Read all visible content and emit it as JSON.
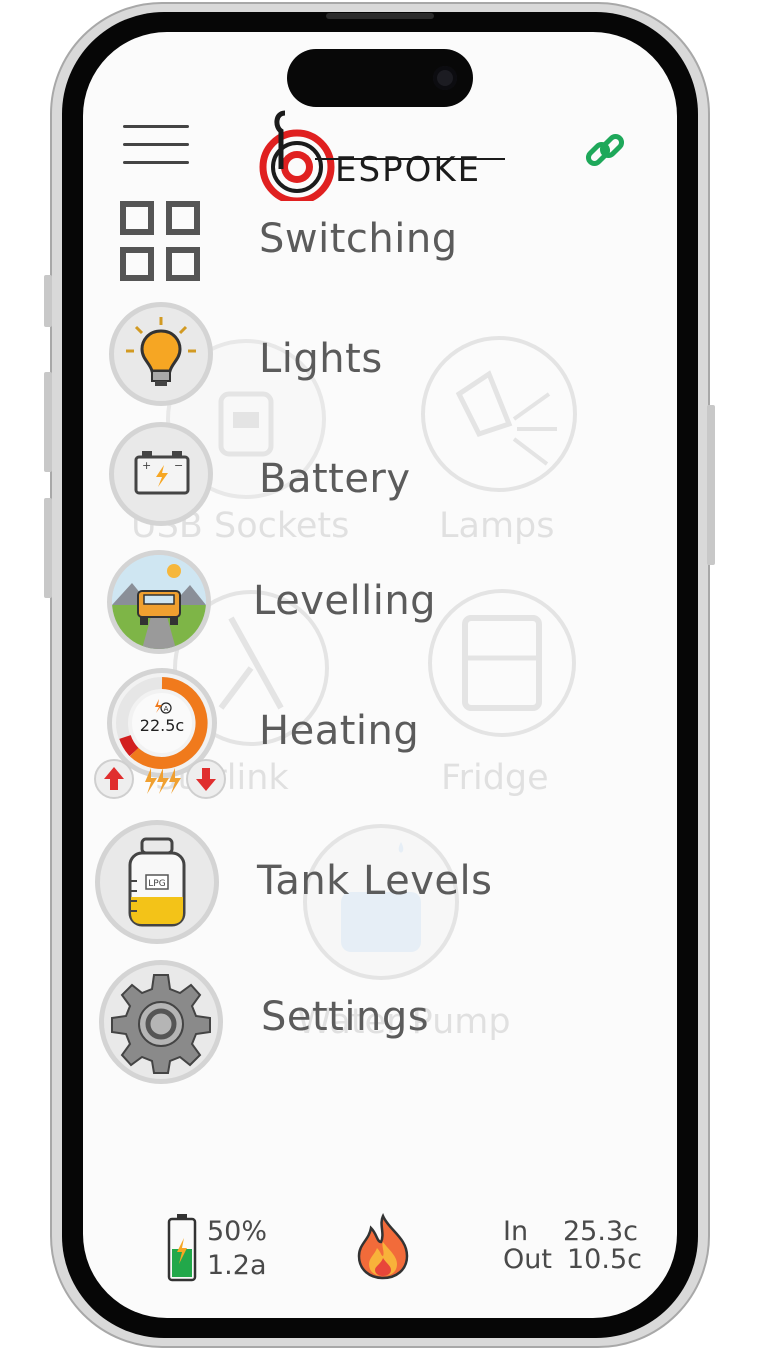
{
  "header": {
    "logo_text": "ESPOKE",
    "menu_icon": "hamburger-menu-icon",
    "link_icon": "link-icon",
    "link_color": "#1ea85a"
  },
  "background_tiles": [
    {
      "label": "USB Sockets",
      "icon": "usb-icon"
    },
    {
      "label": "Lamps",
      "icon": "lamp-icon"
    },
    {
      "label": "Starlink",
      "icon": "satellite-dish-icon"
    },
    {
      "label": "Fridge",
      "icon": "fridge-icon"
    },
    {
      "label": "Water Pump",
      "icon": "water-pump-icon"
    }
  ],
  "menu": [
    {
      "label": "Switching",
      "icon": "grid-icon"
    },
    {
      "label": "Lights",
      "icon": "light-bulb-icon"
    },
    {
      "label": "Battery",
      "icon": "battery-icon"
    },
    {
      "label": "Levelling",
      "icon": "levelling-van-icon"
    },
    {
      "label": "Heating",
      "icon": "heating-dial-icon"
    },
    {
      "label": "Tank Levels",
      "icon": "lpg-tank-icon"
    },
    {
      "label": "Settings",
      "icon": "gear-icon"
    }
  ],
  "heating_widget": {
    "temperature": "22.5c",
    "mode_badge": "A",
    "up_icon": "arrow-up-icon",
    "down_icon": "arrow-down-icon",
    "power_icon": "triple-lightning-icon"
  },
  "tank_widget": {
    "gas_label": "LPG"
  },
  "status": {
    "battery_percent": "50%",
    "battery_current": "1.2a",
    "battery_level": 0.5,
    "flame_icon": "flame-icon",
    "in_label": "In",
    "in_value": "25.3c",
    "out_label": "Out",
    "out_value": "10.5c"
  },
  "colors": {
    "accent_red": "#e02020",
    "heating_orange": "#f07a1c",
    "battery_green": "#22a84a",
    "tank_yellow": "#f3c318"
  }
}
